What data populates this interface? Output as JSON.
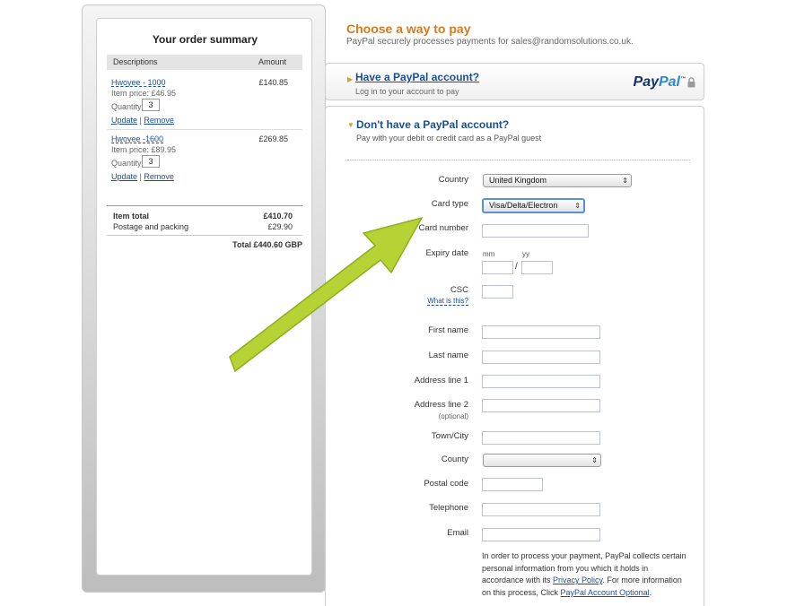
{
  "order_summary": {
    "title": "Your order summary",
    "col_descriptions": "Descriptions",
    "col_amount": "Amount",
    "items": [
      {
        "name": "Hwoyee - 1000",
        "item_price": "Item price: £46.95",
        "quantity_label": "Quantity:",
        "quantity": "3",
        "update": "Update",
        "separator": "|",
        "remove": "Remove",
        "amount": "£140.85"
      },
      {
        "name": "Hwoyee -1600",
        "item_price": "Item price: £89.95",
        "quantity_label": "Quantity:",
        "quantity": "3",
        "update": "Update",
        "separator": "|",
        "remove": "Remove",
        "amount": "£269.85"
      }
    ],
    "item_total_label": "Item total",
    "item_total": "£410.70",
    "postage_label": "Postage and packing",
    "postage": "£29.90",
    "grand_total": "Total £440.60 GBP"
  },
  "payment": {
    "title": "Choose a way to pay",
    "subtitle": "PayPal securely processes payments for sales@randomsolutions.co.uk.",
    "have_account": {
      "heading": "Have a PayPal account?",
      "sub": "Log in to your account to pay",
      "logo_pay": "Pay",
      "logo_pal": "Pal",
      "logo_tm": "™"
    },
    "guest": {
      "heading": "Don't have a PayPal account?",
      "sub": "Pay with your debit or credit card as a PayPal guest"
    },
    "form": {
      "country_label": "Country",
      "country_value": "United Kingdom",
      "card_type_label": "Card type",
      "card_type_value": "Visa/Delta/Electron",
      "card_number_label": "Card number",
      "expiry_label": "Expiry date",
      "mm": "mm",
      "yy": "yy",
      "slash": "/",
      "csc_label": "CSC",
      "what_is_this": "What is this?",
      "first_name_label": "First name",
      "last_name_label": "Last name",
      "address1_label": "Address line 1",
      "address2_label": "Address line 2",
      "optional": "(optional)",
      "town_label": "Town/City",
      "county_label": "County",
      "county_value": "",
      "postal_label": "Postal code",
      "telephone_label": "Telephone",
      "email_label": "Email"
    },
    "notice": {
      "text1": "In order to process your payment, PayPal collects certain personal information from you which it holds in accordance with its ",
      "privacy_link": "Privacy Policy",
      "text2": ". For more information on this process, Click ",
      "optional_link": "PayPal Account Optional",
      "text3": "."
    }
  },
  "colors": {
    "accent_orange": "#d57a1c",
    "link_blue": "#1a4f96",
    "arrow_green": "#b5d334"
  },
  "icons": [
    "arrow-right-icon",
    "arrow-down-icon",
    "lock-icon",
    "caret-icon",
    "green-pointer-arrow"
  ]
}
